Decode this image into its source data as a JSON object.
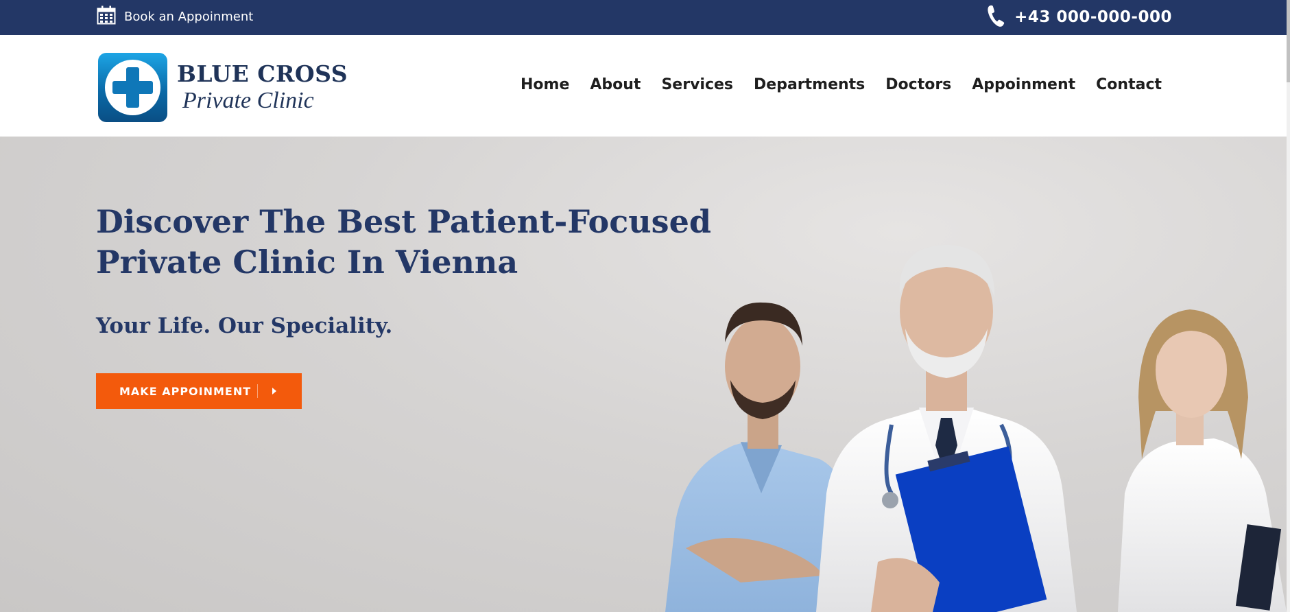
{
  "topbar": {
    "appointment_label": "Book an Appoinment",
    "phone": "+43 000-000-000",
    "bg_color": "#233766",
    "icons": {
      "appointment": "calendar-icon",
      "phone": "phone-icon"
    }
  },
  "header": {
    "logo": {
      "line1": "BLUE CROSS",
      "line2": "Private Clinic",
      "icon": "cross-logo-icon"
    },
    "nav": [
      "Home",
      "About",
      "Services",
      "Departments",
      "Doctors",
      "Appoinment",
      "Contact"
    ]
  },
  "hero": {
    "title_line1": "Discover The Best Patient-Focused",
    "title_line2": "Private Clinic In Vienna",
    "subtitle": "Your Life. Our Speciality.",
    "cta_label": "MAKE APPOINMENT",
    "cta_icon": "caret-right-icon",
    "cta_color": "#f35a0c",
    "title_color": "#233766"
  }
}
